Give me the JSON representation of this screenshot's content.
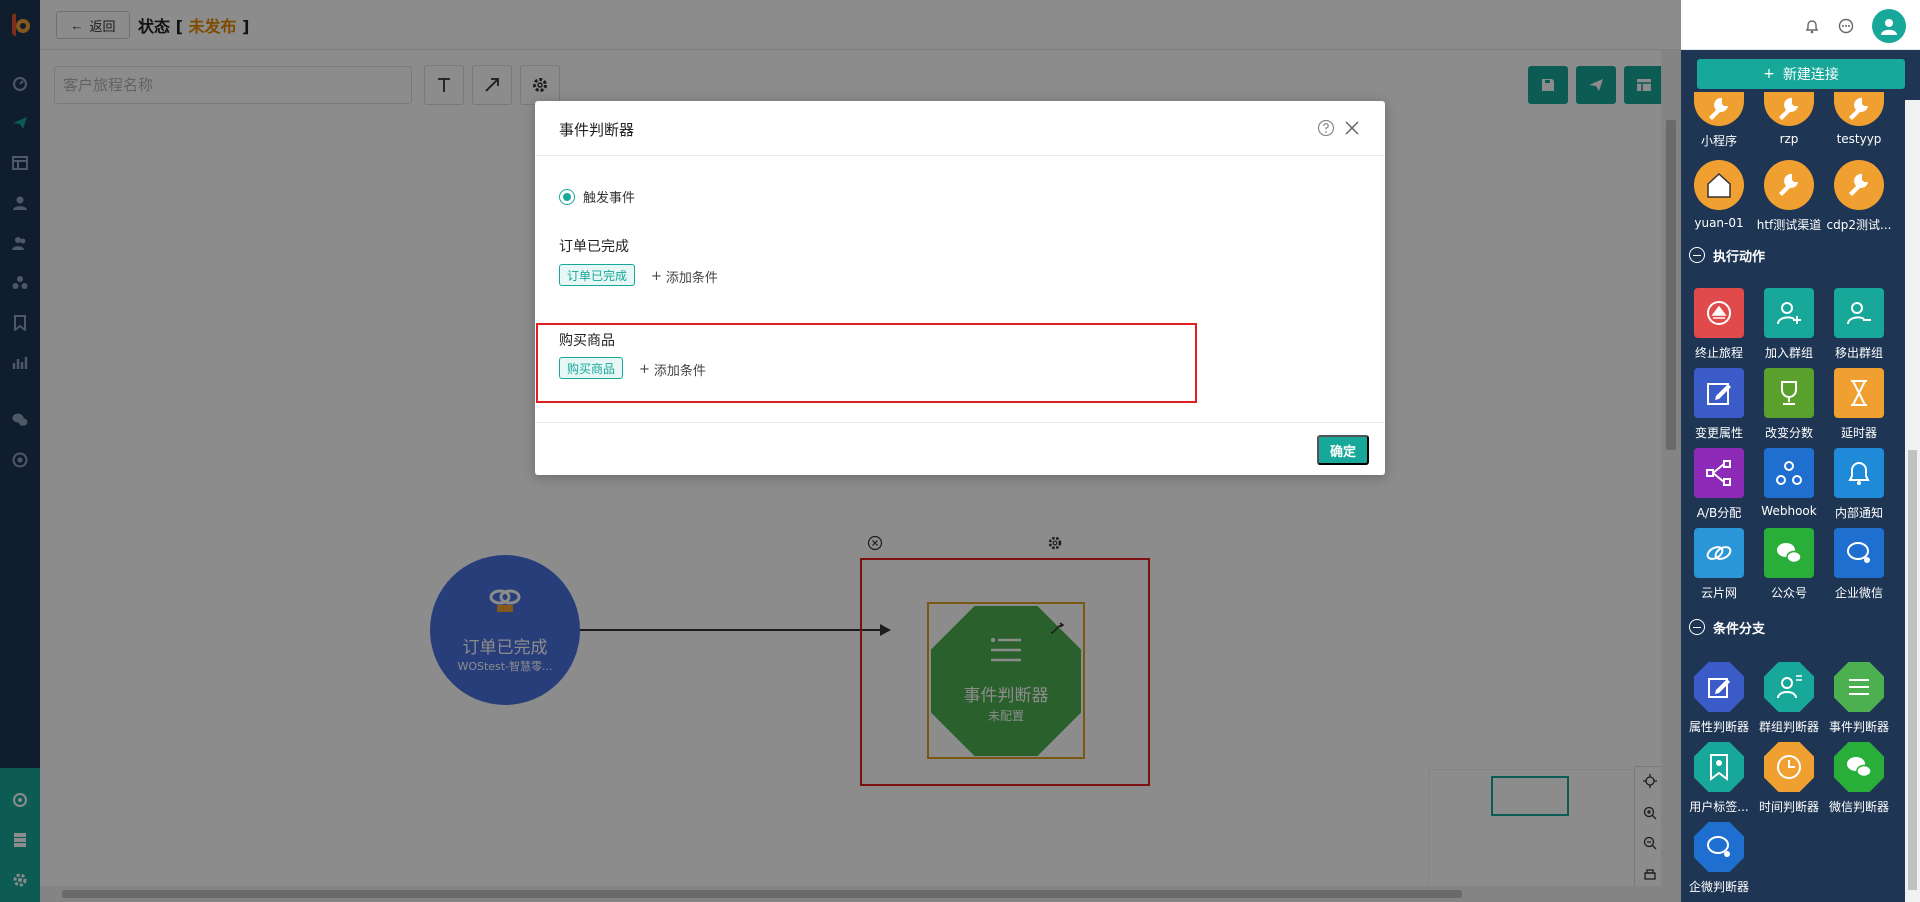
{
  "header": {
    "back_label": "返回",
    "status_prefix": "状态 [",
    "status_value": "未发布",
    "status_suffix": "]"
  },
  "canvas": {
    "name_placeholder": "客户旅程名称",
    "nodes": [
      {
        "title": "订单已完成",
        "subtitle": "WOStest-智慧零...",
        "icon": "link-icon",
        "color": "#4a72e0"
      },
      {
        "title": "事件判断器",
        "subtitle": "未配置",
        "icon": "list-icon",
        "color": "#4caf50"
      }
    ]
  },
  "palette": {
    "new_connection": "新建连接",
    "channels": [
      {
        "label": "小程序",
        "icon": "wrench-icon",
        "color": "#f0a030"
      },
      {
        "label": "rzp",
        "icon": "wrench-icon",
        "color": "#f0a030"
      },
      {
        "label": "testyyp",
        "icon": "wrench-icon",
        "color": "#f0a030"
      },
      {
        "label": "yuan-01",
        "icon": "house-icon",
        "color": "#f0a030"
      },
      {
        "label": "htf测试渠道",
        "icon": "wrench-icon",
        "color": "#f0a030"
      },
      {
        "label": "cdp2测试...",
        "icon": "wrench-icon",
        "color": "#f0a030"
      }
    ],
    "actions_title": "执行动作",
    "actions": [
      {
        "label": "终止旅程",
        "icon": "stop-icon",
        "color": "#e04a4a"
      },
      {
        "label": "加入群组",
        "icon": "user-plus-icon",
        "color": "#17a89a"
      },
      {
        "label": "移出群组",
        "icon": "user-minus-icon",
        "color": "#17a89a"
      },
      {
        "label": "变更属性",
        "icon": "edit-icon",
        "color": "#3a5bc8"
      },
      {
        "label": "改变分数",
        "icon": "trophy-icon",
        "color": "#5aa02c"
      },
      {
        "label": "延时器",
        "icon": "hourglass-icon",
        "color": "#f0a030"
      },
      {
        "label": "A/B分配",
        "icon": "ab-split-icon",
        "color": "#8e2ab8"
      },
      {
        "label": "Webhook",
        "icon": "webhook-icon",
        "color": "#1f6fd0"
      },
      {
        "label": "内部通知",
        "icon": "bell-icon",
        "color": "#1f8ad8"
      },
      {
        "label": "云片网",
        "icon": "cloud-link-icon",
        "color": "#2a96d8"
      },
      {
        "label": "公众号",
        "icon": "wechat-icon",
        "color": "#2aae3a"
      },
      {
        "label": "企业微信",
        "icon": "wecom-icon",
        "color": "#1f6fd0"
      }
    ],
    "branches_title": "条件分支",
    "branches": [
      {
        "label": "属性判断器",
        "icon": "edit-icon",
        "color": "#3a5bc8"
      },
      {
        "label": "群组判断器",
        "icon": "user-list-icon",
        "color": "#17a89a"
      },
      {
        "label": "事件判断器",
        "icon": "list-icon",
        "color": "#4caf50"
      },
      {
        "label": "用户标签...",
        "icon": "bookmark-user-icon",
        "color": "#17a89a"
      },
      {
        "label": "时间判断器",
        "icon": "clock-icon",
        "color": "#f0a030"
      },
      {
        "label": "微信判断器",
        "icon": "wechat-icon",
        "color": "#2aae3a"
      },
      {
        "label": "企微判断器",
        "icon": "wecom-icon",
        "color": "#1f6fd0"
      }
    ]
  },
  "modal": {
    "title": "事件判断器",
    "radio_label": "触发事件",
    "events": [
      {
        "title": "订单已完成",
        "tag": "订单已完成",
        "add_label": "添加条件"
      },
      {
        "title": "购买商品",
        "tag": "购买商品",
        "add_label": "添加条件"
      }
    ],
    "ok_label": "确定"
  },
  "colors": {
    "primary": "#17a89a",
    "nav": "#1e3553",
    "warning": "#e58a00",
    "highlight": "#e02020"
  }
}
